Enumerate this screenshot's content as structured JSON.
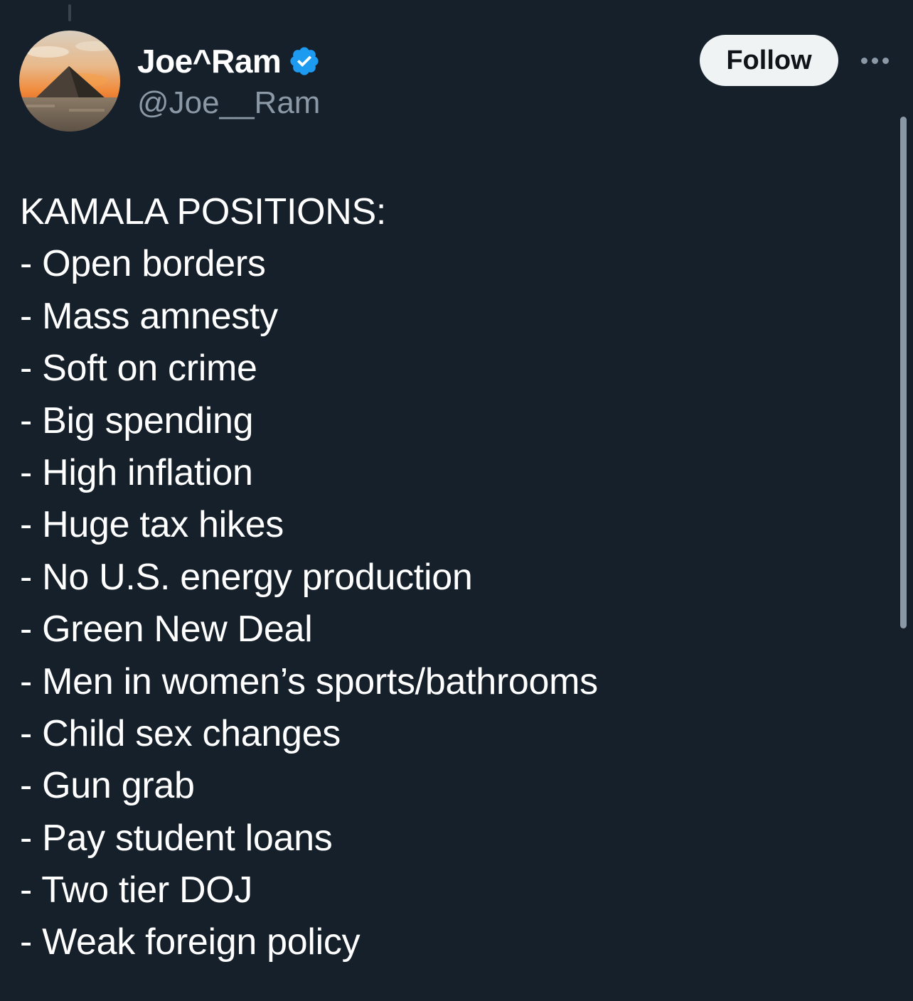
{
  "author": {
    "display_name": "Joe^Ram",
    "handle": "@Joe__Ram",
    "verified": true,
    "verified_color": "#1d9bf0"
  },
  "actions": {
    "follow_label": "Follow"
  },
  "tweet": {
    "lines": [
      "KAMALA POSITIONS:",
      "- Open borders",
      "- Mass amnesty",
      "- Soft on crime",
      "- Big spending",
      "- High inflation",
      "- Huge tax hikes",
      "- No U.S. energy production",
      "- Green New Deal",
      "- Men in women’s sports/bathrooms",
      "- Child sex changes",
      "- Gun grab",
      "- Pay student loans",
      "- Two tier DOJ",
      "- Weak foreign policy"
    ]
  },
  "icons": {
    "avatar": "pyramid-sunset-avatar",
    "verified": "verified-badge-icon",
    "more": "more-options-icon"
  },
  "colors": {
    "background": "#15202b",
    "text_primary": "#ffffff",
    "text_secondary": "#8b98a5",
    "follow_button_bg": "#eff3f4",
    "follow_button_text": "#0f1419"
  }
}
